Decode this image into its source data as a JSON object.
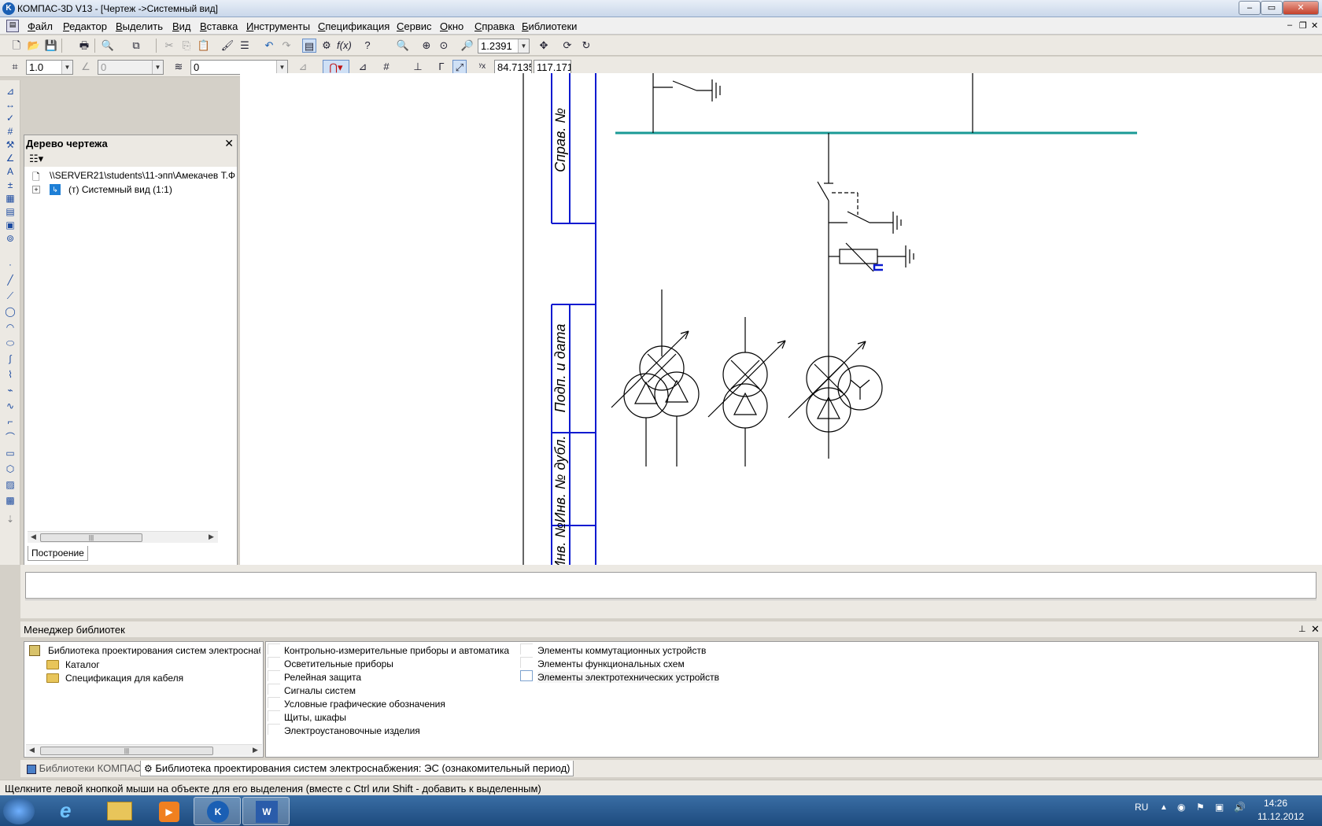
{
  "window": {
    "title": "КОМПАС-3D V13 - [Чертеж ->Системный вид]"
  },
  "menu": [
    "Файл",
    "Редактор",
    "Выделить",
    "Вид",
    "Вставка",
    "Инструменты",
    "Спецификация",
    "Сервис",
    "Окно",
    "Справка",
    "Библиотеки"
  ],
  "toolbar1": {
    "zoom_value": "1.2391"
  },
  "toolbar2": {
    "step_value": "1.0",
    "angle_value": "0",
    "layer_value": "0",
    "coord_x": "84.7135",
    "coord_y": "117.171"
  },
  "tree_panel": {
    "title": "Дерево чертежа",
    "path": "\\\\SERVER21\\students\\11-эпп\\Амекачев Т.Ф",
    "node": "(т) Системный вид (1:1)",
    "tab": "Построение"
  },
  "drawing": {
    "stamp_labels": [
      "Справ. №",
      "Подп. и дата",
      "Инв. № дубл.",
      "Инв. №"
    ],
    "accent_busbar": "#1a9a96",
    "accent_frame": "#0a1ad0"
  },
  "library_manager": {
    "title": "Менеджер библиотек",
    "tree": {
      "root": "Библиотека проектирования систем электроснабже",
      "items": [
        "Каталог",
        "Спецификация для кабеля"
      ]
    },
    "list_col1": [
      "Контрольно-измерительные приборы и автоматика",
      "Осветительные приборы",
      "Релейная защита",
      "Сигналы систем",
      "Условные графические обозначения",
      "Щиты, шкафы",
      "Электроустановочные изделия"
    ],
    "list_col2": [
      "Элементы коммутационных устройств",
      "Элементы функциональных схем",
      "Элементы электротехнических устройств"
    ],
    "tabs": [
      "Библиотеки КОМПАС",
      "Библиотека проектирования систем электроснабжения: ЭС (ознакомительный период)"
    ]
  },
  "status": {
    "text": "Щелкните левой кнопкой мыши на объекте для его выделения (вместе с Ctrl или Shift - добавить к выделенным)"
  },
  "taskbar": {
    "lang": "RU",
    "time": "14:26",
    "date": "11.12.2012"
  }
}
